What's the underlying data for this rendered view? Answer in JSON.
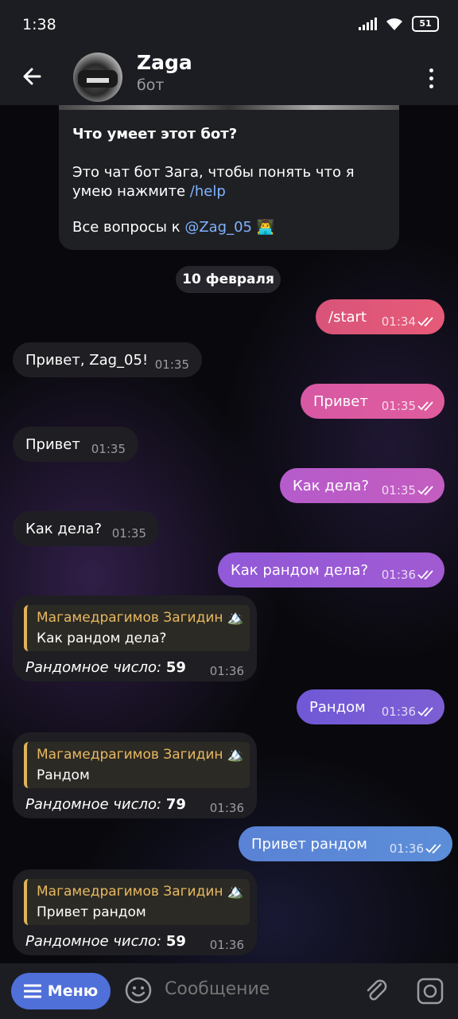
{
  "status": {
    "time": "1:38",
    "battery": "51"
  },
  "header": {
    "title": "Zaga",
    "subtitle": "бот"
  },
  "info": {
    "heading": "Что умеет этот бот?",
    "body": "Это чат бот Зага, чтобы понять что я умею нажмите",
    "help_link": "/help",
    "questions": "Все вопросы к",
    "contact": "@Zag_05",
    "emoji": "👨‍💻"
  },
  "date_separator": "10 февраля",
  "messages": [
    {
      "dir": "out",
      "text": "/start",
      "time": "01:34"
    },
    {
      "dir": "in",
      "text": "Привет, Zag_05!",
      "time": "01:35"
    },
    {
      "dir": "out",
      "text": "Привет",
      "time": "01:35"
    },
    {
      "dir": "in",
      "text": "Привет",
      "time": "01:35"
    },
    {
      "dir": "out",
      "text": "Как дела?",
      "time": "01:35"
    },
    {
      "dir": "in",
      "text": "Как дела?",
      "time": "01:35"
    },
    {
      "dir": "out",
      "text": "Как рандом дела?",
      "time": "01:36"
    },
    {
      "dir": "in-reply",
      "reply_name": "Магамедрагимов Загидин 🏔️",
      "reply_text": "Как рандом дела?",
      "label": "Рандомное число:",
      "number": "59",
      "time": "01:36"
    },
    {
      "dir": "out",
      "text": "Рандом",
      "time": "01:36"
    },
    {
      "dir": "in-reply",
      "reply_name": "Магамедрагимов Загидин 🏔️",
      "reply_text": "Рандом",
      "label": "Рандомное число:",
      "number": "79",
      "time": "01:36"
    },
    {
      "dir": "out",
      "text": "Привет рандом",
      "time": "01:36"
    },
    {
      "dir": "in-reply",
      "reply_name": "Магамедрагимов Загидин 🏔️",
      "reply_text": "Привет рандом",
      "label": "Рандомное число:",
      "number": "59",
      "time": "01:36"
    }
  ],
  "composer": {
    "menu_label": "Меню",
    "placeholder": "Сообщение"
  },
  "colors": {
    "bubble_start": "#e0557a",
    "bubble_privet": "#d95aa6",
    "bubble_kakdela": "#b95cc9",
    "bubble_random_dela": "#9a5ad7",
    "bubble_random": "#7a5fd6",
    "bubble_privet_random": "#5a86d6",
    "incoming": "#1f1f23",
    "menu_button": "#4f6fd9",
    "reply_name": "#e8b860"
  }
}
